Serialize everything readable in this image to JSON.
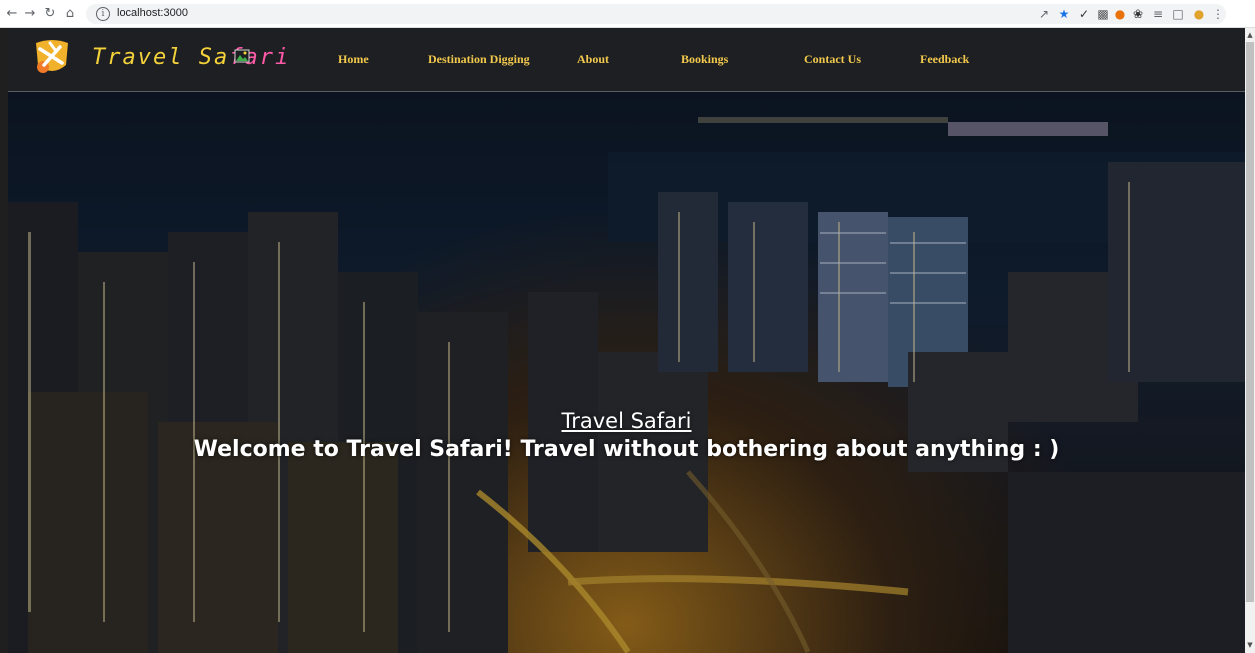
{
  "browser": {
    "url": "localhost:3000",
    "icons": [
      "back-arrow-icon",
      "forward-arrow-icon",
      "reload-icon",
      "home-icon",
      "info-icon",
      "share-icon",
      "bookmark-star-icon",
      "checkmark-extension-icon",
      "extension-icon",
      "extension-icon",
      "puzzle-icon",
      "reading-list-icon",
      "side-panel-icon",
      "profile-avatar-icon",
      "more-menu-icon"
    ]
  },
  "site": {
    "brand_part1": "Travel Sa",
    "brand_part2": "fari",
    "brand_color_1": "#f4d23a",
    "brand_color_2": "#ff5aa8",
    "nav_color": "#f2c94c",
    "nav": [
      "Home",
      "Destination Digging",
      "About",
      "Bookings",
      "Contact Us",
      "Feedback"
    ]
  },
  "hero": {
    "title": "Travel Safari",
    "subtitle": "Welcome to Travel Safari! Travel without bothering about anything : )"
  }
}
